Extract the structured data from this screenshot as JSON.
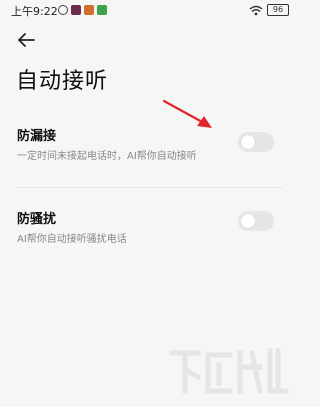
{
  "status_bar": {
    "time": "上午9:22",
    "battery": "96"
  },
  "header": {
    "title": "自动接听"
  },
  "settings": [
    {
      "title": "防漏接",
      "subtitle": "一定时间未接起电话时，AI帮你自动接听",
      "enabled": false
    },
    {
      "title": "防骚扰",
      "subtitle": "AI帮你自动接听骚扰电话",
      "enabled": false
    }
  ],
  "colors": {
    "background": "#f6f6f4",
    "annotation_arrow": "#e0262a",
    "toggle_off": "#e6e6e6"
  },
  "icons": {
    "back": "arrow-left-icon",
    "wifi": "wifi-icon",
    "battery": "battery-icon"
  }
}
